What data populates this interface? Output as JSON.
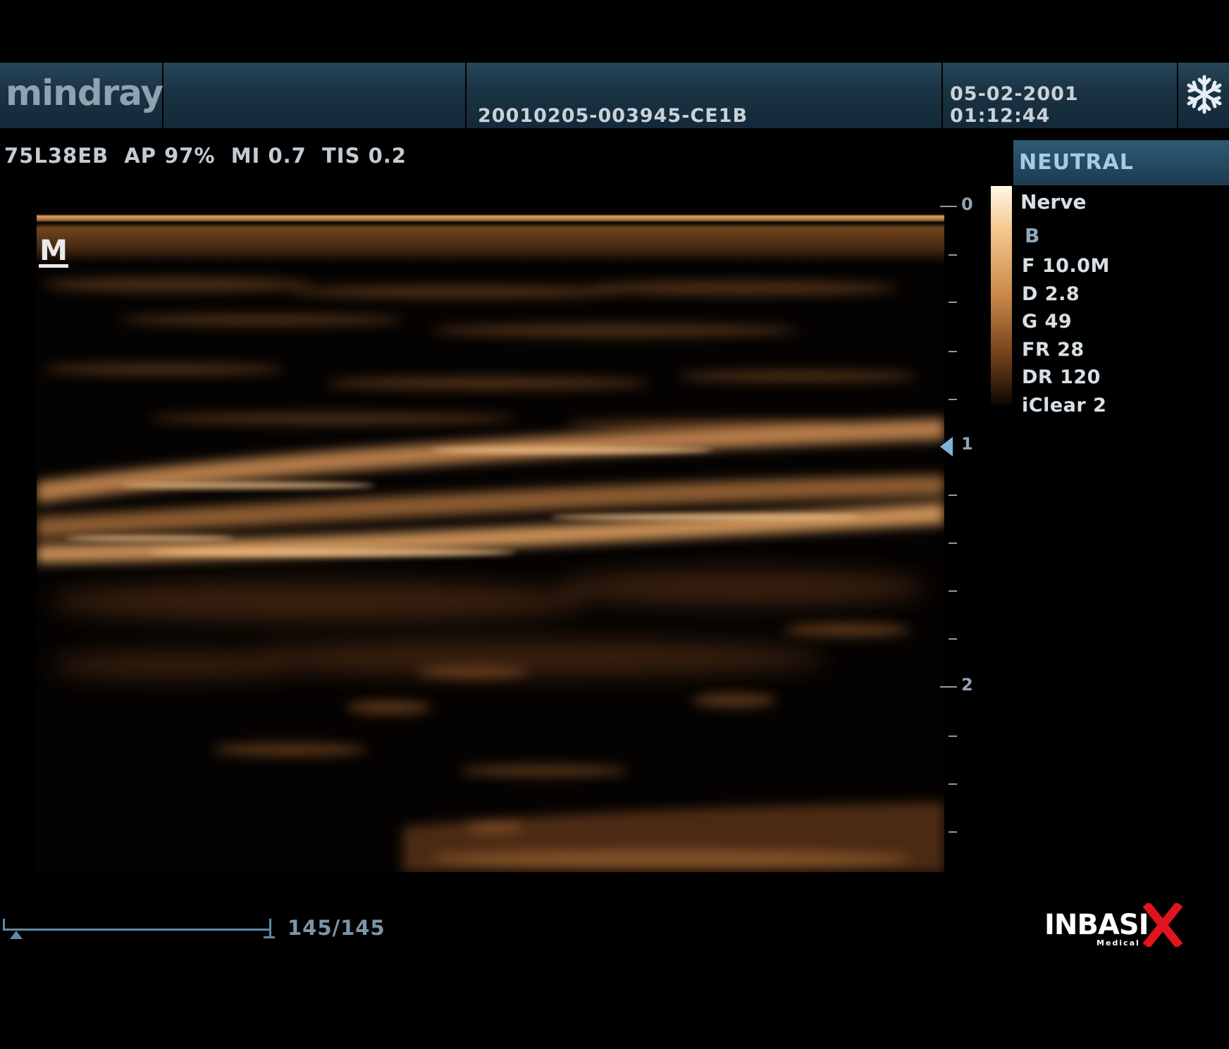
{
  "header": {
    "logo": "mindray",
    "patient_id": "20010205-003945-CE1B",
    "datetime": "05-02-2001 01:12:44",
    "freeze_icon": "snowflake-icon"
  },
  "params_line": "75L38EB  AP 97%  MI 0.7  TIS 0.2",
  "image_marker": "M",
  "depth_scale": {
    "labels": [
      "0",
      "1",
      "2"
    ],
    "focus_depth": 1.0,
    "max_depth": 2.8
  },
  "right_panel": {
    "tag": "NEUTRAL",
    "preset": "Nerve",
    "mode": "B",
    "params": [
      "F 10.0M",
      "D 2.8",
      "G 49",
      "FR 28",
      "DR 120",
      "iClear 2"
    ]
  },
  "cine": {
    "frame_count": "145/145",
    "position": 1.0
  },
  "watermark": {
    "text": "inbasi",
    "x_letter": "X",
    "sub": "Medical"
  },
  "colors": {
    "header_bg": "#1a3242",
    "accent_blue": "#5f89a6",
    "tint": "#c98847",
    "watermark_x": "#e0141e"
  }
}
